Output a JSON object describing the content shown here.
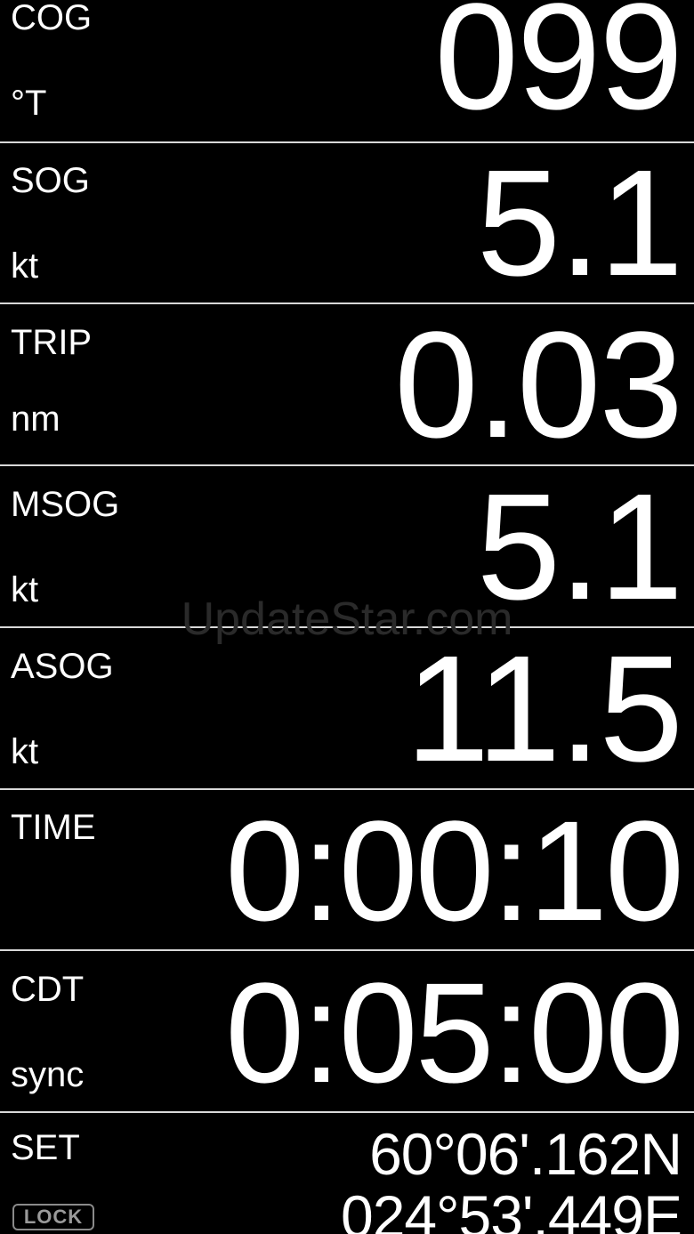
{
  "rows": [
    {
      "name": "COG",
      "unit": "°T",
      "value": "099"
    },
    {
      "name": "SOG",
      "unit": "kt",
      "value": "5.1"
    },
    {
      "name": "TRIP",
      "unit": "nm",
      "value": "0.03"
    },
    {
      "name": "MSOG",
      "unit": "kt",
      "value": "5.1"
    },
    {
      "name": "ASOG",
      "unit": "kt",
      "value": "11.5"
    },
    {
      "name": "TIME",
      "unit": "",
      "value": "0:00:10"
    },
    {
      "name": "CDT",
      "unit": "sync",
      "value": "0:05:00"
    }
  ],
  "set_row": {
    "name": "SET",
    "latitude": "60°06'.162N",
    "longitude": "024°53'.449E",
    "lock_label": "LOCK"
  },
  "watermark": "UpdateStar.com",
  "colors": {
    "background": "#000000",
    "text": "#ffffff",
    "divider": "#d8d8d8",
    "lock": "#8a8a8a",
    "watermark": "#2a2a2a"
  }
}
